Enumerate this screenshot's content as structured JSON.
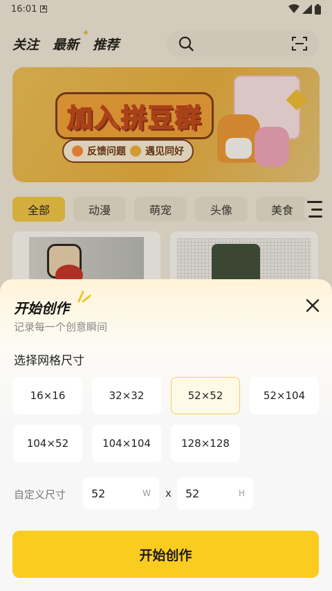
{
  "status_bar": {
    "time": "16:01",
    "notif_glyph": "A",
    "icons": [
      "wifi-icon",
      "signal-icon",
      "battery-icon"
    ]
  },
  "header": {
    "tabs": [
      {
        "label": "关注"
      },
      {
        "label": "最新"
      },
      {
        "label": "推荐"
      }
    ],
    "search": {
      "icon": "search-icon",
      "scan_icon": "scan-icon"
    }
  },
  "banner": {
    "title": "加入拼豆群",
    "pills": [
      {
        "label": "反馈问题"
      },
      {
        "label": "遇见同好"
      }
    ]
  },
  "categories": {
    "items": [
      {
        "label": "全部",
        "active": true
      },
      {
        "label": "动漫"
      },
      {
        "label": "萌宠"
      },
      {
        "label": "头像"
      },
      {
        "label": "美食"
      }
    ],
    "filter_icon": "menu-icon"
  },
  "sheet": {
    "title": "开始创作",
    "subtitle": "记录每一个创意瞬间",
    "grid_label": "选择网格尺寸",
    "sizes": [
      "16×16",
      "32×32",
      "52×52",
      "52×104",
      "104×52",
      "104×104",
      "128×128"
    ],
    "selected_size": "52×52",
    "custom": {
      "label": "自定义尺寸",
      "width_value": "52",
      "width_unit": "W",
      "times": "x",
      "height_value": "52",
      "height_unit": "H"
    },
    "start_button": "开始创作"
  },
  "colors": {
    "accent": "#fbcc20",
    "selected_border": "#f2cf63",
    "category_active": "#f6cb48"
  }
}
